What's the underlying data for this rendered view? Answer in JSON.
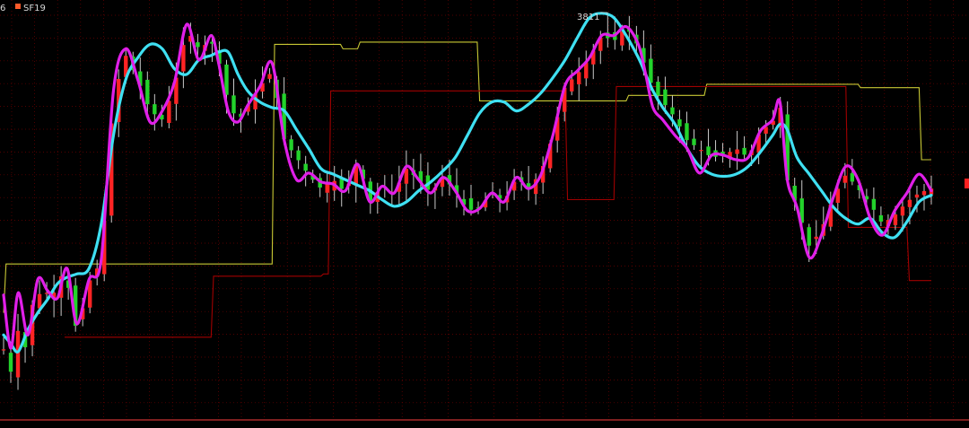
{
  "legend": {
    "left_text": "6",
    "item_label": "SF19",
    "item_color": "#ff5a2a"
  },
  "annotations": [
    {
      "text": "3811",
      "color": "#e0e0e0"
    }
  ],
  "colors": {
    "background": "#000000",
    "grid": "#6e0000",
    "up": "#ff2424",
    "down": "#23d32b",
    "wick": "#c9c9c9",
    "ma_fast": "#e01fe8",
    "ma_slow": "#3fe0f2",
    "band_upper": "#c8c834",
    "band_lower": "#a00000",
    "bottom_axis": "#c83232",
    "right_marker": "#ff2020"
  },
  "chart_data": {
    "type": "candlestick",
    "title": "",
    "xlabel": "",
    "ylabel": "",
    "grid": true,
    "legend": "top-left",
    "ylim": [
      3445,
      3822
    ],
    "candle_count": 130,
    "series": [
      {
        "name": "SF19",
        "kind": "candles",
        "color": "#ff2424",
        "close_path": [
          [
            0,
            3507
          ],
          [
            2,
            3475
          ],
          [
            6,
            3525
          ],
          [
            8,
            3498
          ],
          [
            12,
            3550
          ],
          [
            16,
            3560
          ],
          [
            20,
            3555
          ],
          [
            25,
            3580
          ],
          [
            30,
            3522
          ],
          [
            35,
            3568
          ],
          [
            40,
            3586
          ],
          [
            45,
            3735
          ],
          [
            50,
            3772
          ],
          [
            55,
            3750
          ],
          [
            60,
            3722
          ],
          [
            65,
            3714
          ],
          [
            70,
            3745
          ],
          [
            75,
            3795
          ],
          [
            80,
            3778
          ],
          [
            85,
            3785
          ],
          [
            88,
            3768
          ],
          [
            92,
            3730
          ],
          [
            96,
            3712
          ],
          [
            100,
            3727
          ],
          [
            105,
            3744
          ],
          [
            110,
            3758
          ],
          [
            115,
            3695
          ],
          [
            120,
            3680
          ],
          [
            125,
            3664
          ],
          [
            130,
            3652
          ],
          [
            135,
            3660
          ],
          [
            140,
            3648
          ],
          [
            145,
            3678
          ],
          [
            150,
            3640
          ],
          [
            155,
            3654
          ],
          [
            160,
            3648
          ],
          [
            165,
            3670
          ],
          [
            170,
            3660
          ],
          [
            175,
            3648
          ],
          [
            180,
            3662
          ],
          [
            185,
            3650
          ],
          [
            190,
            3632
          ],
          [
            195,
            3635
          ],
          [
            200,
            3648
          ],
          [
            205,
            3640
          ],
          [
            210,
            3662
          ],
          [
            215,
            3652
          ],
          [
            220,
            3666
          ],
          [
            225,
            3700
          ],
          [
            230,
            3745
          ],
          [
            235,
            3755
          ],
          [
            240,
            3770
          ],
          [
            245,
            3790
          ],
          [
            250,
            3785
          ],
          [
            255,
            3798
          ],
          [
            260,
            3780
          ],
          [
            263,
            3760
          ],
          [
            266,
            3742
          ],
          [
            270,
            3730
          ],
          [
            275,
            3716
          ],
          [
            280,
            3695
          ],
          [
            285,
            3688
          ],
          [
            290,
            3680
          ],
          [
            295,
            3682
          ],
          [
            300,
            3688
          ],
          [
            305,
            3680
          ],
          [
            310,
            3704
          ],
          [
            315,
            3712
          ],
          [
            318,
            3728
          ],
          [
            321,
            3660
          ],
          [
            325,
            3635
          ],
          [
            330,
            3600
          ],
          [
            335,
            3615
          ],
          [
            340,
            3645
          ],
          [
            345,
            3665
          ],
          [
            350,
            3652
          ],
          [
            355,
            3638
          ],
          [
            360,
            3620
          ],
          [
            365,
            3628
          ],
          [
            370,
            3640
          ],
          [
            375,
            3648
          ],
          [
            380,
            3652
          ]
        ],
        "high": 3811,
        "last_close": 3665
      },
      {
        "name": "",
        "kind": "line",
        "color": "#e01fe8",
        "points": [
          [
            0,
            3556
          ],
          [
            3,
            3508
          ],
          [
            6,
            3558
          ],
          [
            10,
            3520
          ],
          [
            14,
            3570
          ],
          [
            18,
            3560
          ],
          [
            22,
            3553
          ],
          [
            26,
            3580
          ],
          [
            30,
            3530
          ],
          [
            35,
            3570
          ],
          [
            40,
            3588
          ],
          [
            45,
            3740
          ],
          [
            50,
            3778
          ],
          [
            55,
            3750
          ],
          [
            60,
            3712
          ],
          [
            65,
            3722
          ],
          [
            70,
            3748
          ],
          [
            75,
            3800
          ],
          [
            80,
            3768
          ],
          [
            85,
            3790
          ],
          [
            88,
            3766
          ],
          [
            92,
            3722
          ],
          [
            96,
            3712
          ],
          [
            100,
            3727
          ],
          [
            105,
            3744
          ],
          [
            110,
            3765
          ],
          [
            115,
            3695
          ],
          [
            120,
            3660
          ],
          [
            125,
            3666
          ],
          [
            130,
            3658
          ],
          [
            135,
            3656
          ],
          [
            140,
            3650
          ],
          [
            145,
            3674
          ],
          [
            150,
            3640
          ],
          [
            155,
            3654
          ],
          [
            160,
            3648
          ],
          [
            165,
            3672
          ],
          [
            170,
            3660
          ],
          [
            175,
            3648
          ],
          [
            180,
            3662
          ],
          [
            185,
            3650
          ],
          [
            190,
            3632
          ],
          [
            195,
            3634
          ],
          [
            200,
            3648
          ],
          [
            205,
            3640
          ],
          [
            210,
            3662
          ],
          [
            215,
            3652
          ],
          [
            220,
            3664
          ],
          [
            225,
            3700
          ],
          [
            230,
            3745
          ],
          [
            235,
            3758
          ],
          [
            240,
            3770
          ],
          [
            245,
            3790
          ],
          [
            250,
            3790
          ],
          [
            255,
            3798
          ],
          [
            260,
            3782
          ],
          [
            263,
            3755
          ],
          [
            266,
            3725
          ],
          [
            270,
            3714
          ],
          [
            275,
            3700
          ],
          [
            280,
            3688
          ],
          [
            285,
            3666
          ],
          [
            290,
            3682
          ],
          [
            295,
            3682
          ],
          [
            300,
            3678
          ],
          [
            305,
            3680
          ],
          [
            310,
            3704
          ],
          [
            315,
            3714
          ],
          [
            318,
            3730
          ],
          [
            321,
            3660
          ],
          [
            325,
            3635
          ],
          [
            330,
            3590
          ],
          [
            335,
            3610
          ],
          [
            340,
            3645
          ],
          [
            345,
            3672
          ],
          [
            350,
            3660
          ],
          [
            355,
            3625
          ],
          [
            360,
            3610
          ],
          [
            365,
            3632
          ],
          [
            370,
            3648
          ],
          [
            375,
            3665
          ],
          [
            380,
            3650
          ]
        ]
      },
      {
        "name": "",
        "kind": "line",
        "color": "#3fe0f2",
        "points": [
          [
            0,
            3520
          ],
          [
            3,
            3512
          ],
          [
            6,
            3505
          ],
          [
            10,
            3525
          ],
          [
            14,
            3540
          ],
          [
            18,
            3552
          ],
          [
            22,
            3566
          ],
          [
            26,
            3572
          ],
          [
            30,
            3575
          ],
          [
            35,
            3580
          ],
          [
            40,
            3620
          ],
          [
            45,
            3700
          ],
          [
            50,
            3750
          ],
          [
            55,
            3770
          ],
          [
            60,
            3782
          ],
          [
            65,
            3778
          ],
          [
            70,
            3760
          ],
          [
            75,
            3755
          ],
          [
            80,
            3768
          ],
          [
            85,
            3772
          ],
          [
            88,
            3775
          ],
          [
            92,
            3775
          ],
          [
            96,
            3755
          ],
          [
            100,
            3740
          ],
          [
            105,
            3730
          ],
          [
            110,
            3725
          ],
          [
            115,
            3722
          ],
          [
            120,
            3705
          ],
          [
            125,
            3688
          ],
          [
            130,
            3670
          ],
          [
            135,
            3665
          ],
          [
            140,
            3660
          ],
          [
            145,
            3655
          ],
          [
            150,
            3650
          ],
          [
            155,
            3642
          ],
          [
            160,
            3636
          ],
          [
            165,
            3640
          ],
          [
            170,
            3650
          ],
          [
            175,
            3658
          ],
          [
            180,
            3668
          ],
          [
            185,
            3680
          ],
          [
            190,
            3700
          ],
          [
            195,
            3720
          ],
          [
            200,
            3730
          ],
          [
            205,
            3730
          ],
          [
            210,
            3722
          ],
          [
            215,
            3728
          ],
          [
            220,
            3738
          ],
          [
            225,
            3752
          ],
          [
            230,
            3768
          ],
          [
            235,
            3788
          ],
          [
            240,
            3806
          ],
          [
            245,
            3810
          ],
          [
            250,
            3806
          ],
          [
            255,
            3790
          ],
          [
            260,
            3770
          ],
          [
            263,
            3755
          ],
          [
            266,
            3740
          ],
          [
            270,
            3725
          ],
          [
            275,
            3710
          ],
          [
            280,
            3688
          ],
          [
            285,
            3672
          ],
          [
            290,
            3665
          ],
          [
            295,
            3663
          ],
          [
            300,
            3665
          ],
          [
            305,
            3672
          ],
          [
            310,
            3685
          ],
          [
            315,
            3700
          ],
          [
            318,
            3710
          ],
          [
            321,
            3705
          ],
          [
            325,
            3680
          ],
          [
            330,
            3665
          ],
          [
            335,
            3650
          ],
          [
            340,
            3635
          ],
          [
            345,
            3625
          ],
          [
            350,
            3620
          ],
          [
            355,
            3625
          ],
          [
            360,
            3612
          ],
          [
            365,
            3608
          ],
          [
            370,
            3622
          ],
          [
            375,
            3640
          ],
          [
            380,
            3646
          ]
        ]
      },
      {
        "name": "",
        "kind": "step",
        "color": "#c8c834",
        "points": [
          [
            0,
            3540
          ],
          [
            1,
            3584
          ],
          [
            110,
            3584
          ],
          [
            111,
            3782
          ],
          [
            138,
            3782
          ],
          [
            139,
            3778
          ],
          [
            145,
            3778
          ],
          [
            146,
            3784
          ],
          [
            194,
            3784
          ],
          [
            195,
            3731
          ],
          [
            255,
            3731
          ],
          [
            256,
            3736
          ],
          [
            287,
            3736
          ],
          [
            288,
            3746
          ],
          [
            350,
            3746
          ],
          [
            351,
            3743
          ],
          [
            375,
            3743
          ],
          [
            376,
            3678
          ],
          [
            380,
            3678
          ]
        ]
      },
      {
        "name": "",
        "kind": "step",
        "color": "#a00000",
        "points": [
          [
            25,
            3518
          ],
          [
            85,
            3518
          ],
          [
            86,
            3573
          ],
          [
            130,
            3573
          ],
          [
            131,
            3575
          ],
          [
            133,
            3575
          ],
          [
            134,
            3740
          ],
          [
            230,
            3740
          ],
          [
            231,
            3642
          ],
          [
            250,
            3642
          ],
          [
            251,
            3744
          ],
          [
            345,
            3744
          ],
          [
            346,
            3617
          ],
          [
            370,
            3617
          ],
          [
            371,
            3569
          ],
          [
            380,
            3569
          ]
        ]
      }
    ]
  }
}
